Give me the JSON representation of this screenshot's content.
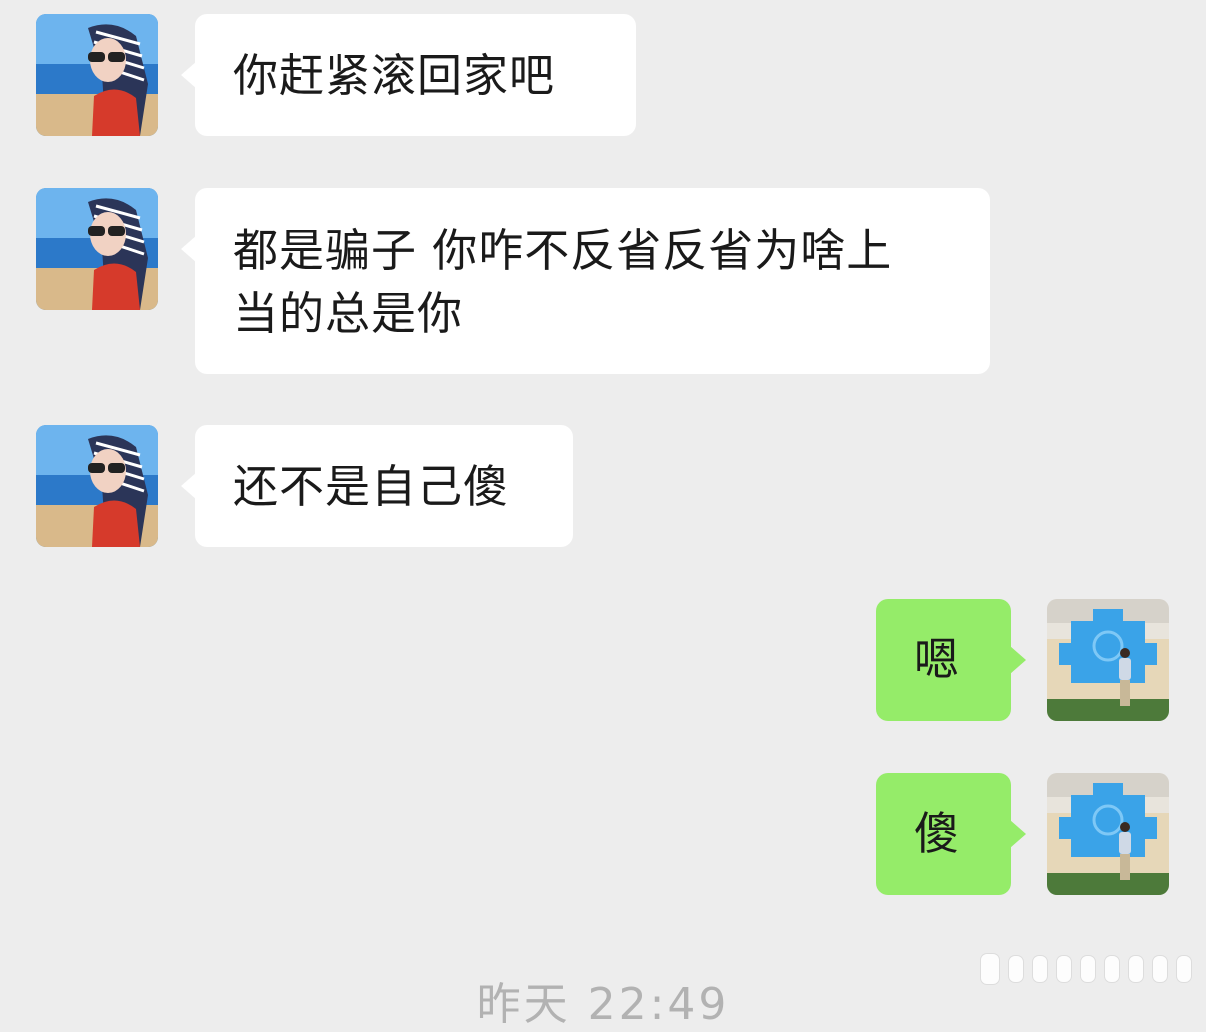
{
  "conversation": {
    "messages": [
      {
        "sender": "contact",
        "text": "你赶紧滚回家吧",
        "avatar_icon": "woman-sunglasses-beach-avatar"
      },
      {
        "sender": "contact",
        "text_lines": [
          "都是骗子 你咋不反省反省为啥上",
          "当的总是你"
        ],
        "avatar_icon": "woman-sunglasses-beach-avatar"
      },
      {
        "sender": "contact",
        "text": "还不是自己傻",
        "avatar_icon": "woman-sunglasses-beach-avatar"
      },
      {
        "sender": "me",
        "text": "嗯",
        "avatar_icon": "man-standing-blue-backdrop-avatar"
      },
      {
        "sender": "me",
        "text": "傻",
        "avatar_icon": "man-standing-blue-backdrop-avatar"
      }
    ],
    "timestamp": "昨天 22:49"
  },
  "colors": {
    "background": "#ededed",
    "incoming_bubble": "#ffffff",
    "outgoing_bubble": "#95ec69",
    "text": "#1a1a1a",
    "timestamp": "#b2b2b2"
  },
  "watermark_icon": "weibo-watermark-icon"
}
